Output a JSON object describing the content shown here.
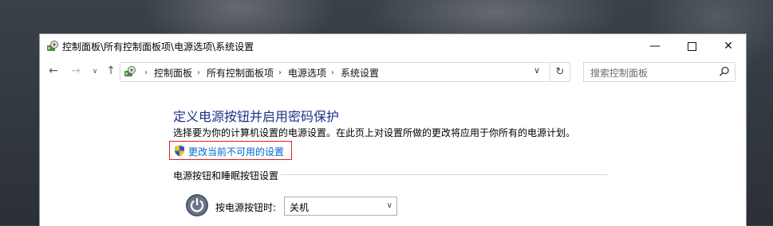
{
  "window": {
    "title": "控制面板\\所有控制面板项\\电源选项\\系统设置",
    "icon": "control-panel-icon",
    "controls": {
      "minimize": "—",
      "maximize": "",
      "close": "✕"
    }
  },
  "navigation": {
    "back": "←",
    "forward": "→",
    "recent": "∨",
    "up": "↑",
    "breadcrumbs": [
      "控制面板",
      "所有控制面板项",
      "电源选项",
      "系统设置"
    ],
    "dropdown": "∨",
    "refresh": "↻"
  },
  "search": {
    "placeholder": "搜索控制面板"
  },
  "main": {
    "heading": "定义电源按钮并启用密码保护",
    "description": "选择要为你的计算机设置的电源设置。在此页上对设置所做的更改将应用于你所有的电源计划。",
    "change_link": "更改当前不可用的设置",
    "section_title": "电源按钮和睡眠按钮设置",
    "power_button_label": "按电源按钮时:",
    "power_button_value": "关机"
  },
  "colors": {
    "heading": "#1e3287",
    "link": "#0066cc",
    "highlight_border": "#e02020"
  }
}
